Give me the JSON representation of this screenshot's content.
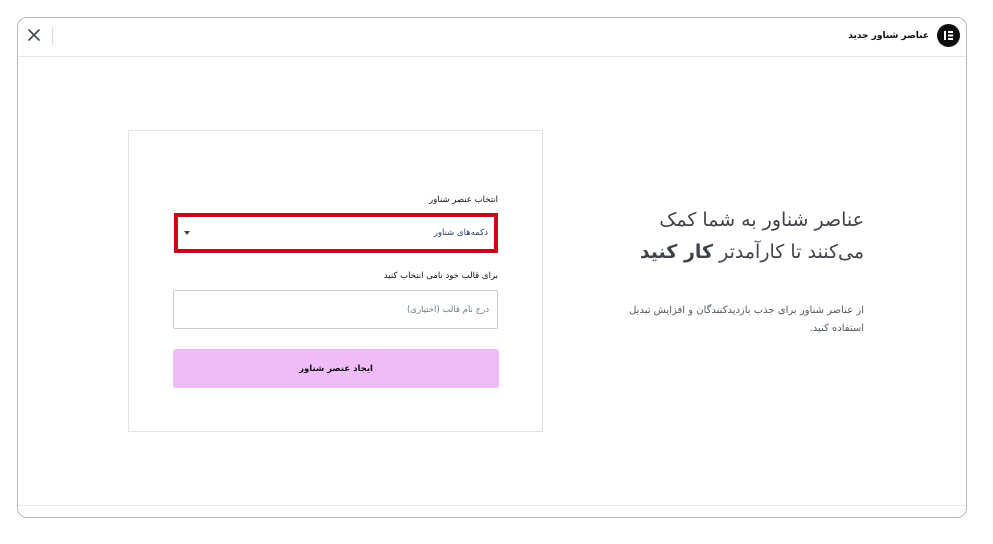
{
  "header": {
    "title": "عناصر شناور جدید",
    "close_icon": "close-icon",
    "logo_icon": "elementor-logo-icon"
  },
  "info": {
    "headline_line1": "عناصر شناور به شما کمک",
    "headline_line2_prefix": "می‌کنند تا کارآمدتر ",
    "headline_line2_strong": "کار کنید",
    "description": "از عناصر شناور برای جذب بازدیدکنندگان و افزایش تبدیل استفاده کنید."
  },
  "form": {
    "type_label": "انتخاب عنصر شناور",
    "type_value": "دکمه‌های شناور",
    "name_label": "برای قالب خود نامی انتخاب کنید",
    "name_value": "",
    "name_placeholder": "درج نام قالب (اختیاری)",
    "submit_label": "ایجاد عنصر شناور"
  },
  "colors": {
    "accent_button": "#f0bbf9",
    "highlight_border": "#d0021b",
    "logo_bg": "#0c0d0e"
  }
}
